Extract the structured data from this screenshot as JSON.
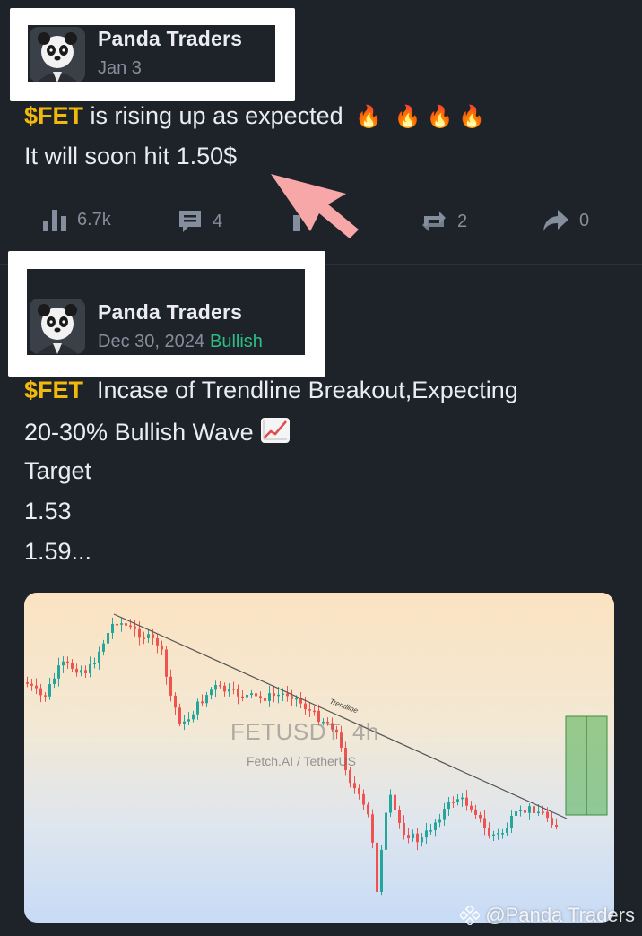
{
  "posts": [
    {
      "author": "Panda Traders",
      "date": "Jan 3",
      "ticker": "$FET",
      "line1_rest": " is rising up as expected",
      "line2": "It will soon hit 1.50$",
      "actions": {
        "views": "6.7k",
        "comments": "4",
        "reposts": "2",
        "shares": "0"
      }
    },
    {
      "author": "Panda Traders",
      "date": "Dec 30, 2024",
      "sentiment": "Bullish",
      "ticker": "$FET",
      "line1_rest": "  Incase of Trendline Breakout,Expecting",
      "line2": "20-30% Bullish Wave",
      "line3": "Target",
      "line4": "1.53",
      "line5": "1.59..."
    }
  ],
  "chart": {
    "symbol": "FETUSDT, 4h",
    "pair": "Fetch.AI / TetherUS",
    "trendline_label": "Trendline"
  },
  "watermark": "@Panda Traders",
  "colors": {
    "background": "#1e2329",
    "ticker": "#f0b90b",
    "bullish": "#2ebd85",
    "muted": "#848e9c",
    "highlight_frame": "#ffffff",
    "arrow": "#f7a7a7"
  }
}
